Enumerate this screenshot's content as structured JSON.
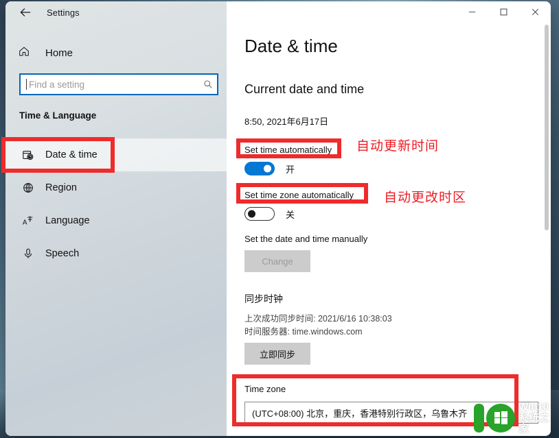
{
  "window": {
    "title": "Settings",
    "back_icon": "back-arrow-icon",
    "minimize_label": "—",
    "maximize_label": "□",
    "close_label": "✕"
  },
  "sidebar": {
    "home_label": "Home",
    "home_icon": "home-icon",
    "search": {
      "placeholder": "Find a setting",
      "value": "",
      "icon": "search-icon"
    },
    "section_header": "Time & Language",
    "items": [
      {
        "label": "Date & time",
        "icon": "calendar-clock-icon",
        "selected": true
      },
      {
        "label": "Region",
        "icon": "globe-icon",
        "selected": false
      },
      {
        "label": "Language",
        "icon": "language-icon",
        "selected": false
      },
      {
        "label": "Speech",
        "icon": "microphone-icon",
        "selected": false
      }
    ]
  },
  "main": {
    "page_title": "Date & time",
    "current_section_title": "Current date and time",
    "current_datetime": "8:50, 2021年6月17日",
    "set_time_auto": {
      "label": "Set time automatically",
      "state_label": "开",
      "on": true
    },
    "set_timezone_auto": {
      "label": "Set time zone automatically",
      "state_label": "关",
      "on": false
    },
    "manual_label": "Set the date and time manually",
    "change_button": "Change",
    "change_button_disabled": true,
    "sync_section_title": "同步时钟",
    "last_sync": "上次成功同步时间: 2021/6/16 10:38:03",
    "time_server": "时间服务器: time.windows.com",
    "sync_now_button": "立即同步",
    "timezone_label": "Time zone",
    "timezone_value": "(UTC+08:00) 北京，重庆，香港特别行政区，乌鲁木齐"
  },
  "annotations": {
    "color": "#ed1c24",
    "note_time_auto": "自动更新时间",
    "note_timezone_auto": "自动更改时区"
  },
  "watermark": {
    "line1": "Win10",
    "line2": "系统之家",
    "color": "#29a329"
  }
}
